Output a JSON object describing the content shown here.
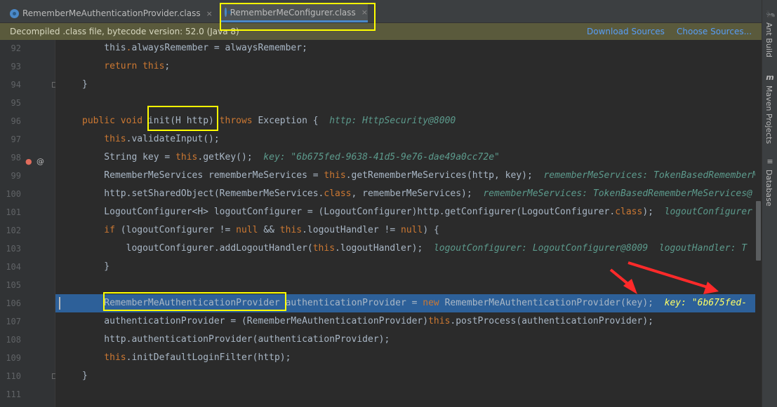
{
  "tabs": [
    {
      "label": "RememberMeAuthenticationProvider.class",
      "close": "×"
    },
    {
      "label": "RememberMeConfigurer.class",
      "close": "×"
    }
  ],
  "notice": {
    "message": "Decompiled .class file, bytecode version: 52.0 (Java 8)",
    "download_sources": "Download Sources",
    "choose_sources": "Choose Sources..."
  },
  "sidebar": {
    "ant_build": "Ant Build",
    "maven_projects": "Maven Projects",
    "database": "Database",
    "maven_icon": "m"
  },
  "lines": [
    {
      "num": "92",
      "segments": [
        [
          "p",
          "    this"
        ],
        [
          "k",
          "."
        ],
        [
          "p",
          "alwaysRemember = alwaysRemember;"
        ]
      ]
    },
    {
      "num": "93",
      "segments": [
        [
          "k",
          "    return this"
        ],
        [
          "p",
          ";"
        ]
      ]
    },
    {
      "num": "94",
      "segments": [
        [
          "p",
          "}"
        ]
      ]
    },
    {
      "num": "95",
      "segments": []
    },
    {
      "num": "96",
      "segments": [
        [
          "k",
          "public void "
        ],
        [
          "p",
          "init(H http) "
        ],
        [
          "k",
          "throws "
        ],
        [
          "p",
          "Exception {  "
        ],
        [
          "i",
          "http: HttpSecurity@8000"
        ]
      ]
    },
    {
      "num": "97",
      "segments": [
        [
          "k",
          "    this"
        ],
        [
          "p",
          ".validateInput();"
        ]
      ]
    },
    {
      "num": "98",
      "segments": [
        [
          "p",
          "    String key = "
        ],
        [
          "k",
          "this"
        ],
        [
          "p",
          ".getKey();  "
        ],
        [
          "i",
          "key: \"6b675fed-9638-41d5-9e76-dae49a0cc72e\""
        ]
      ]
    },
    {
      "num": "99",
      "segments": [
        [
          "p",
          "    RememberMeServices rememberMeServices = "
        ],
        [
          "k",
          "this"
        ],
        [
          "p",
          ".getRememberMeServices(http, key);  "
        ],
        [
          "i",
          "rememberMeServices: TokenBasedRememberMeServices@"
        ]
      ]
    },
    {
      "num": "100",
      "segments": [
        [
          "p",
          "    http.setSharedObject(RememberMeServices."
        ],
        [
          "k",
          "class"
        ],
        [
          "p",
          ", rememberMeServices);  "
        ],
        [
          "i",
          "rememberMeServices: TokenBasedRememberMeServices@"
        ]
      ]
    },
    {
      "num": "101",
      "segments": [
        [
          "p",
          "    LogoutConfigurer<H> logoutConfigurer = (LogoutConfigurer)http.getConfigurer(LogoutConfigurer."
        ],
        [
          "k",
          "class"
        ],
        [
          "p",
          ");  "
        ],
        [
          "i",
          "logoutConfigurer"
        ]
      ]
    },
    {
      "num": "102",
      "segments": [
        [
          "k",
          "    if "
        ],
        [
          "p",
          "(logoutConfigurer != "
        ],
        [
          "k",
          "null "
        ],
        [
          "p",
          "&& "
        ],
        [
          "k",
          "this"
        ],
        [
          "p",
          ".logoutHandler != "
        ],
        [
          "k",
          "null"
        ],
        [
          "p",
          ") {"
        ]
      ]
    },
    {
      "num": "103",
      "segments": [
        [
          "p",
          "        logoutConfigurer.addLogoutHandler("
        ],
        [
          "k",
          "this"
        ],
        [
          "p",
          ".logoutHandler);  "
        ],
        [
          "i",
          "logoutConfigurer: LogoutConfigurer@8009  logoutHandler: T"
        ]
      ]
    },
    {
      "num": "104",
      "segments": [
        [
          "p",
          "    }"
        ]
      ]
    },
    {
      "num": "105",
      "segments": []
    },
    {
      "num": "106",
      "segments": [
        [
          "p",
          "    RememberMeAuthenticationProvider authenticationProvider = "
        ],
        [
          "k",
          "new "
        ],
        [
          "p",
          "RememberMeAuthenticationProvider(key);  "
        ],
        [
          "s",
          "key: \"6b675fed-"
        ]
      ]
    },
    {
      "num": "107",
      "segments": [
        [
          "p",
          "    authenticationProvider = (RememberMeAuthenticationProvider)"
        ],
        [
          "k",
          "this"
        ],
        [
          "p",
          ".postProcess(authenticationProvider);"
        ]
      ]
    },
    {
      "num": "108",
      "segments": [
        [
          "p",
          "    http.authenticationProvider(authenticationProvider);"
        ]
      ]
    },
    {
      "num": "109",
      "segments": [
        [
          "k",
          "    this"
        ],
        [
          "p",
          ".initDefaultLoginFilter(http);"
        ]
      ]
    },
    {
      "num": "110",
      "segments": [
        [
          "p",
          "}"
        ]
      ]
    },
    {
      "num": "111",
      "segments": []
    }
  ],
  "colors": {
    "keyword": "#cc7832",
    "plain": "#a9b7c6",
    "inline_hint": "#5c9a8c",
    "selection": "#2d6099",
    "highlight_box": "#ffff00",
    "arrow": "#ff2a2a"
  }
}
